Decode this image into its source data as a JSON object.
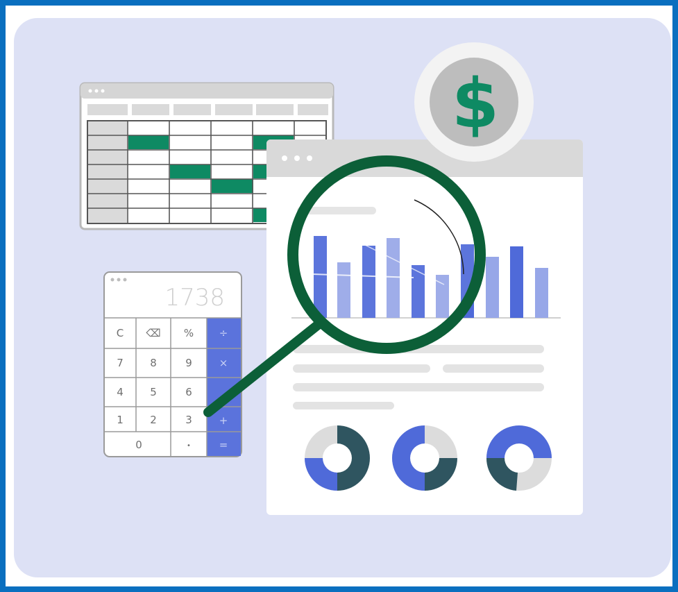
{
  "calculator": {
    "display": "1738",
    "keys": {
      "c": "C",
      "backspace": "⌫",
      "percent": "%",
      "divide": "÷",
      "seven": "7",
      "eight": "8",
      "nine": "9",
      "multiply": "×",
      "four": "4",
      "five": "5",
      "six": "6",
      "one": "1",
      "two": "2",
      "three": "3",
      "plus": "+",
      "zero": "0",
      "dot": "•",
      "equals": "="
    }
  },
  "coin": {
    "symbol": "$"
  },
  "colors": {
    "border": "#0a6fbf",
    "panel": "#dde1f5",
    "green": "#0e8a63",
    "dark_green": "#0c5f38",
    "bar_dark": "#4f6ad9",
    "bar_light": "#97a7e8",
    "donut_slate": "#2f5560",
    "donut_gray": "#dcdcdc",
    "donut_blue": "#4f6ad9"
  },
  "icons": [
    "dollar-coin-icon",
    "magnifying-glass-icon",
    "spreadsheet-icon",
    "calculator-icon",
    "bar-chart-icon",
    "donut-chart-icon"
  ]
}
